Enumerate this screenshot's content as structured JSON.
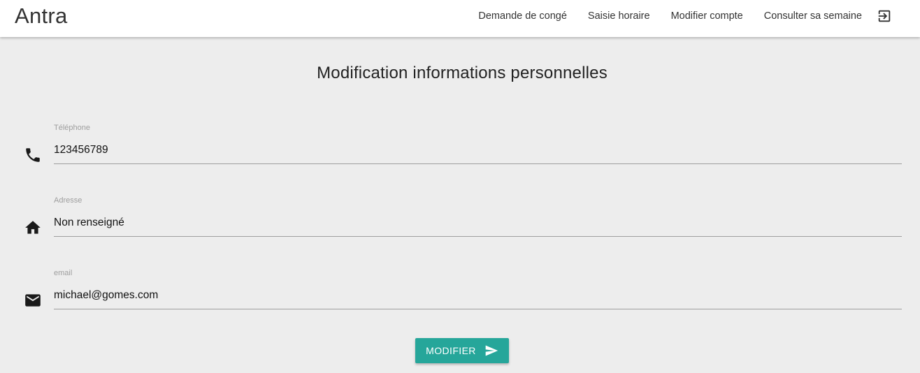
{
  "app": {
    "brand": "Antra"
  },
  "nav": {
    "items": [
      {
        "label": "Demande de congé"
      },
      {
        "label": "Saisie horaire"
      },
      {
        "label": "Modifier compte"
      },
      {
        "label": "Consulter sa semaine"
      }
    ],
    "logout_icon": "exit-to-app-icon"
  },
  "page": {
    "title": "Modification informations personnelles"
  },
  "form": {
    "phone": {
      "label": "Téléphone",
      "value": "123456789",
      "icon": "phone-icon"
    },
    "address": {
      "label": "Adresse",
      "value": "Non renseigné",
      "icon": "home-icon"
    },
    "email": {
      "label": "email",
      "value": "michael@gomes.com",
      "icon": "mail-icon"
    },
    "submit_label": "MODIFIER",
    "submit_icon": "send-icon"
  },
  "colors": {
    "accent": "#26a69a",
    "background": "#ededed",
    "navbar": "#ffffff"
  }
}
